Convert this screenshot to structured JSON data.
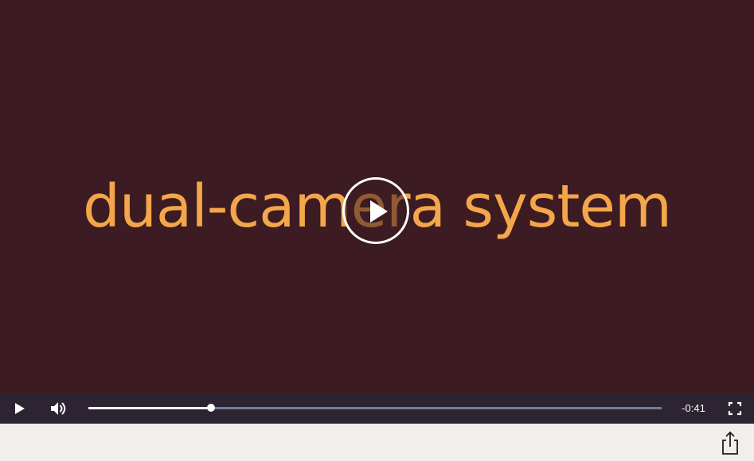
{
  "video": {
    "headline": "dual-camera system"
  },
  "controls": {
    "time_remaining": "-0:41",
    "progress": 0.214
  },
  "colors": {
    "video_background": "#3c1b22",
    "headline_text": "#f3a64a",
    "controls_background": "#2c2431",
    "seek_track": "#6f7f96",
    "seek_played": "#ffffff",
    "page_background": "#f2eeeb"
  },
  "icons": {
    "big_play": "play-circle-icon",
    "play": "play-icon",
    "volume": "volume-icon",
    "fullscreen": "fullscreen-icon",
    "share": "share-icon"
  }
}
